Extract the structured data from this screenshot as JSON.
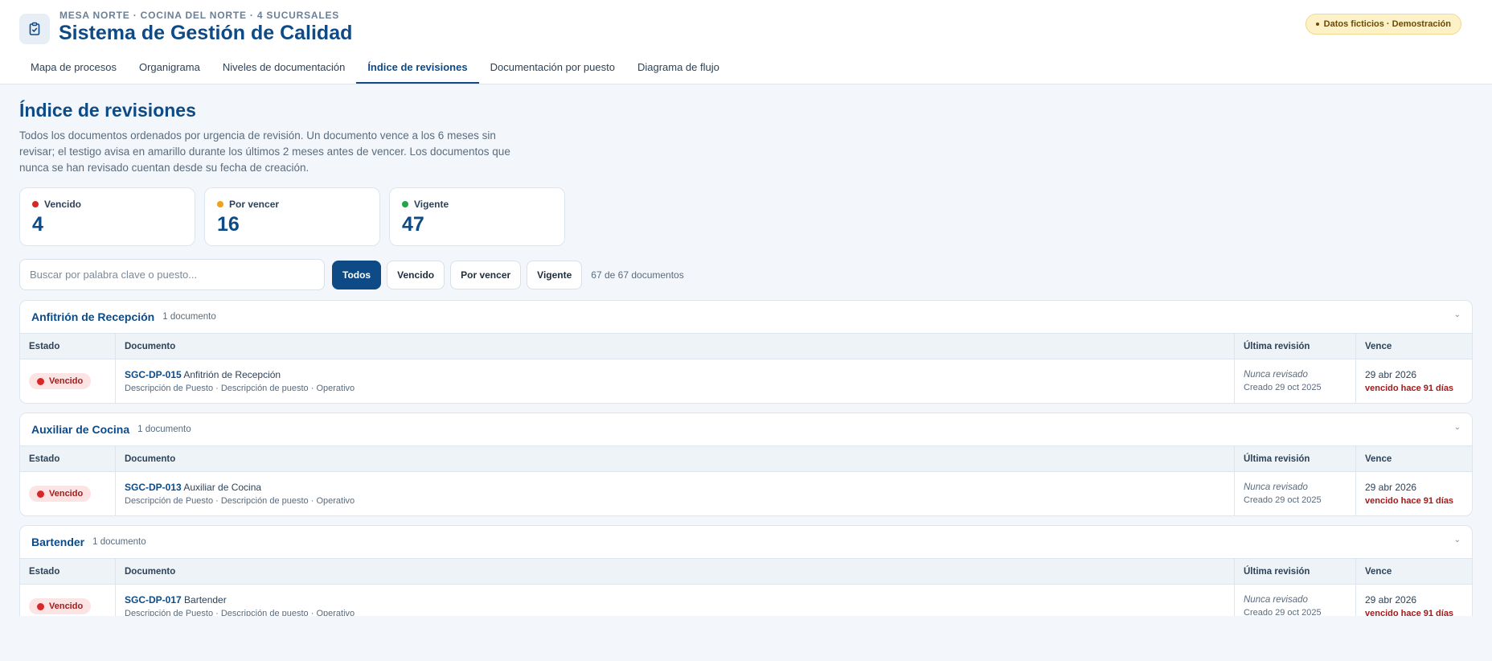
{
  "header": {
    "eyebrow": "MESA NORTE · COCINA DEL NORTE · 4 SUCURSALES",
    "title": "Sistema de Gestión de Calidad",
    "badge": "Datos ficticios · Demostración",
    "app_icon": "clipboard-check-icon"
  },
  "tabs": [
    {
      "label": "Mapa de procesos"
    },
    {
      "label": "Organigrama"
    },
    {
      "label": "Niveles de documentación"
    },
    {
      "label": "Índice de revisiones",
      "active": true
    },
    {
      "label": "Documentación por puesto"
    },
    {
      "label": "Diagrama de flujo"
    }
  ],
  "page": {
    "title": "Índice de revisiones",
    "description": "Todos los documentos ordenados por urgencia de revisión. Un documento vence a los 6 meses sin revisar; el testigo avisa en amarillo durante los últimos 2 meses antes de vencer. Los documentos que nunca se han revisado cuentan desde su fecha de creación."
  },
  "stats": [
    {
      "label": "Vencido",
      "value": "4",
      "color": "#d62828"
    },
    {
      "label": "Por vencer",
      "value": "16",
      "color": "#f0a11c"
    },
    {
      "label": "Vigente",
      "value": "47",
      "color": "#22a447"
    }
  ],
  "toolbar": {
    "search_placeholder": "Buscar por palabra clave o puesto...",
    "filters": [
      "Todos",
      "Vencido",
      "Por vencer",
      "Vigente"
    ],
    "active_filter": "Todos",
    "count": "67 de 67 documentos"
  },
  "columns": [
    "Estado",
    "Documento",
    "Última revisión",
    "Vence"
  ],
  "groups": [
    {
      "name": "Anfitrión de Recepción",
      "count": "1 documento",
      "rows": [
        {
          "status": "Vencido",
          "code": "SGC-DP-015",
          "title": "Anfitrión de Recepción",
          "meta": "Descripción de Puesto · Descripción de puesto · Operativo",
          "last_review": "Nunca revisado",
          "created": "Creado 29 oct 2025",
          "due": "29 abr 2026",
          "due_note": "vencido hace 91 días"
        }
      ]
    },
    {
      "name": "Auxiliar de Cocina",
      "count": "1 documento",
      "rows": [
        {
          "status": "Vencido",
          "code": "SGC-DP-013",
          "title": "Auxiliar de Cocina",
          "meta": "Descripción de Puesto · Descripción de puesto · Operativo",
          "last_review": "Nunca revisado",
          "created": "Creado 29 oct 2025",
          "due": "29 abr 2026",
          "due_note": "vencido hace 91 días"
        }
      ]
    },
    {
      "name": "Bartender",
      "count": "1 documento",
      "rows": [
        {
          "status": "Vencido",
          "code": "SGC-DP-017",
          "title": "Bartender",
          "meta": "Descripción de Puesto · Descripción de puesto · Operativo",
          "last_review": "Nunca revisado",
          "created": "Creado 29 oct 2025",
          "due": "29 abr 2026",
          "due_note": "vencido hace 91 días"
        }
      ]
    }
  ]
}
